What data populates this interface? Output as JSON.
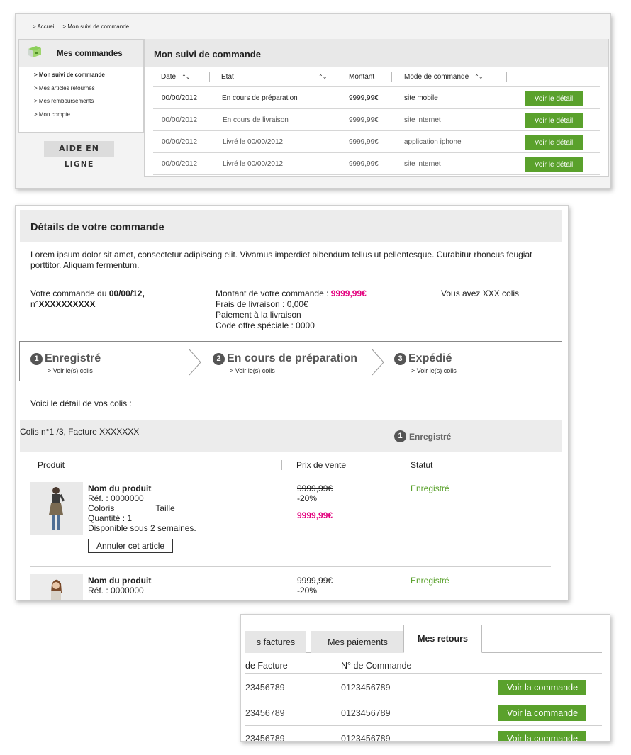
{
  "panel1": {
    "breadcrumb": [
      "> Accueil",
      "> Mon suivi de commande"
    ],
    "sidebar": {
      "title": "Mes commandes",
      "items": [
        {
          "label": "> Mon suivi de commande",
          "active": true
        },
        {
          "label": "> Mes articles retournés",
          "active": false
        },
        {
          "label": "> Mes remboursements",
          "active": false
        },
        {
          "label": "> Mon compte",
          "active": false
        }
      ]
    },
    "help_button": "AIDE EN LIGNE",
    "main_title": "Mon suivi de commande",
    "columns": [
      "Date",
      "Etat",
      "Montant",
      "Mode de commande"
    ],
    "rows": [
      {
        "date": "00/00/2012",
        "etat": "En cours de préparation",
        "montant": "9999,99€",
        "mode": "site mobile",
        "action": "Voir le détail"
      },
      {
        "date": "00/00/2012",
        "etat": "En cours de livraison",
        "montant": "9999,99€",
        "mode": "site internet",
        "action": "Voir le détail"
      },
      {
        "date": "00/00/2012",
        "etat": "Livré le 00/00/2012",
        "montant": "9999,99€",
        "mode": "application iphone",
        "action": "Voir le détail"
      },
      {
        "date": "00/00/2012",
        "etat": "Livré le 00/00/2012",
        "montant": "9999,99€",
        "mode": "site internet",
        "action": "Voir le détail"
      }
    ]
  },
  "panel2": {
    "title": "Détails de votre commande",
    "lorem": "Lorem ipsum dolor sit amet, consectetur adipiscing elit. Vivamus imperdiet bibendum tellus ut pellentesque. Curabitur rhoncus feugiat porttitor. Aliquam fermentum.",
    "order_prefix": "Votre commande du ",
    "order_date": "00/00/12,",
    "order_num_prefix": "n°",
    "order_num": "XXXXXXXXXX",
    "montant_label": "Montant de votre commande : ",
    "montant_value": "9999,99€",
    "frais": "Frais de livraison : 0,00€",
    "paiement": "Paiement à la livraison",
    "code": "Code offre spéciale : 0000",
    "colis_count": "Vous avez XXX colis",
    "steps": [
      {
        "num": "1",
        "label": "Enregistré",
        "link": "> Voir le(s) colis"
      },
      {
        "num": "2",
        "label": "En cours de préparation",
        "link": "> Voir le(s) colis"
      },
      {
        "num": "3",
        "label": "Expédié",
        "link": "> Voir le(s) colis"
      }
    ],
    "voici": "Voici le détail de vos colis :",
    "colis": {
      "title": "Colis n°1 /3, Facture XXXXXXX",
      "status_num": "1",
      "status": "Enregistré"
    },
    "product_columns": [
      "Produit",
      "Prix de vente",
      "Statut"
    ],
    "products": [
      {
        "name": "Nom du produit",
        "ref": "Réf. : 0000000",
        "coloris": "Coloris",
        "taille": "Taille",
        "quantite": "Quantité : 1",
        "dispo": "Disponible sous 2 semaines.",
        "cancel": "Annuler cet article",
        "old_price": "9999,99€",
        "discount": "-20%",
        "new_price": "9999,99€",
        "status": "Enregistré"
      },
      {
        "name": "Nom du produit",
        "ref": "Réf. : 0000000",
        "old_price": "9999,99€",
        "discount": "-20%",
        "status": "Enregistré"
      }
    ]
  },
  "panel3": {
    "tabs": [
      "s factures",
      "Mes paiements",
      "Mes retours"
    ],
    "active_tab": "Mes retours",
    "columns": [
      "de Facture",
      "N° de Commande"
    ],
    "rows": [
      {
        "facture": "23456789",
        "commande": "0123456789",
        "action": "Voir la commande"
      },
      {
        "facture": "23456789",
        "commande": "0123456789",
        "action": "Voir la commande"
      },
      {
        "facture": "23456789",
        "commande": "0123456789",
        "action": "Voir la commande"
      }
    ]
  },
  "colors": {
    "accent_green": "#5aa12c",
    "price_pink": "#e3007e",
    "header_gray": "#ececec"
  }
}
